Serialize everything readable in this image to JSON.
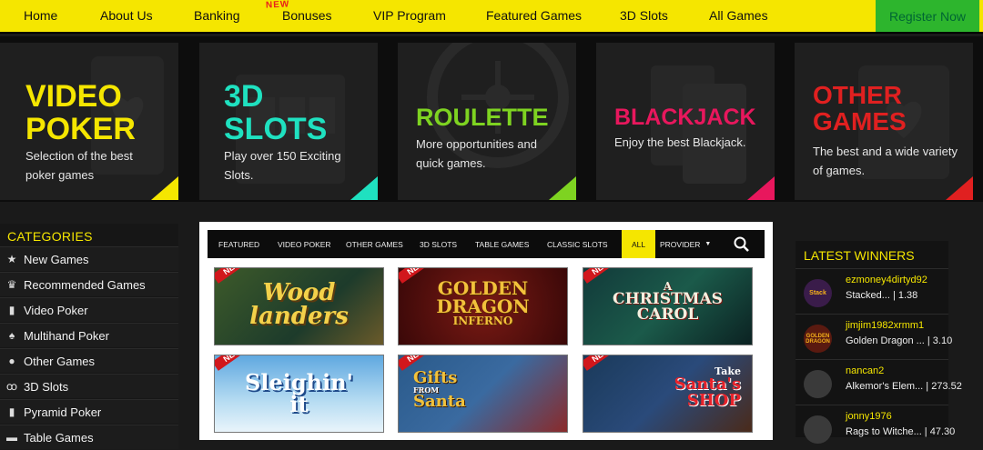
{
  "nav": {
    "items": [
      "Home",
      "About Us",
      "Banking",
      "Bonuses",
      "VIP Program",
      "Featured Games",
      "3D Slots",
      "All Games"
    ],
    "new_badge": "NEW",
    "register": "Register Now"
  },
  "tiles": [
    {
      "title_line1": "VIDEO",
      "title_line2": "POKER",
      "desc_line1": "Selection of the best",
      "desc_line2": "poker games",
      "color": "#f5e600"
    },
    {
      "title_line1": "3D",
      "title_line2": "SLOTS",
      "desc_line1": "Play over 150 Exciting",
      "desc_line2": "Slots.",
      "color": "#1fe1c0"
    },
    {
      "title_line1": "ROULETTE",
      "desc_line1": "More opportunities and",
      "desc_line2": "quick games.",
      "color": "#7ed321"
    },
    {
      "title_line1": "BLACKJACK",
      "desc_line1": "Enjoy the best Blackjack.",
      "color": "#e8175d"
    },
    {
      "title_line1": "OTHER",
      "title_line2": "GAMES",
      "desc_line1": "The best and a wide variety",
      "desc_line2": "of games.",
      "color": "#e02020"
    }
  ],
  "sidebar": {
    "heading": "CATEGORIES",
    "items": [
      {
        "label": "New Games",
        "icon": "star-icon"
      },
      {
        "label": "Recommended Games",
        "icon": "crown-icon"
      },
      {
        "label": "Video Poker",
        "icon": "card-icon"
      },
      {
        "label": "Multihand Poker",
        "icon": "spade-icon"
      },
      {
        "label": "Other Games",
        "icon": "chip-icon"
      },
      {
        "label": "3D Slots",
        "icon": "cherry-icon"
      },
      {
        "label": "Pyramid Poker",
        "icon": "cards-icon"
      },
      {
        "label": "Table Games",
        "icon": "table-icon"
      }
    ]
  },
  "game_tabs": [
    "FEATURED",
    "VIDEO POKER",
    "OTHER GAMES",
    "3D SLOTS",
    "TABLE GAMES",
    "CLASSIC SLOTS",
    "ALL",
    "PROVIDER"
  ],
  "games": [
    {
      "line1": "Wood",
      "line2": "landers",
      "ribbon": "NEW"
    },
    {
      "line1": "GOLDEN",
      "line2": "DRAGON",
      "line3": "INFERNO",
      "ribbon": "NEW"
    },
    {
      "line1": "A",
      "line2": "CHRISTMAS",
      "line3": "CAROL",
      "ribbon": "NEW"
    },
    {
      "line1": "Sleighin'",
      "line2": "it",
      "ribbon": "NEW"
    },
    {
      "line1": "Gifts",
      "line2": "FROM",
      "line3": "Santa",
      "ribbon": "NEW"
    },
    {
      "line1": "Take",
      "line2": "Santa's",
      "line3": "SHOP",
      "ribbon": "NEW"
    }
  ],
  "winners": {
    "heading": "LATEST WINNERS",
    "items": [
      {
        "name": "ezmoney4dirtyd92",
        "game": "Stacked... | 1.38",
        "avatar": "Stack"
      },
      {
        "name": "jimjim1982xrmm1",
        "game": "Golden Dragon ... | 3.10",
        "avatar": "GOLDEN DRAGON"
      },
      {
        "name": "nancan2",
        "game": "Alkemor's Elem... | 273.52",
        "avatar": ""
      },
      {
        "name": "jonny1976",
        "game": "Rags to Witche... | 47.30",
        "avatar": ""
      }
    ]
  }
}
